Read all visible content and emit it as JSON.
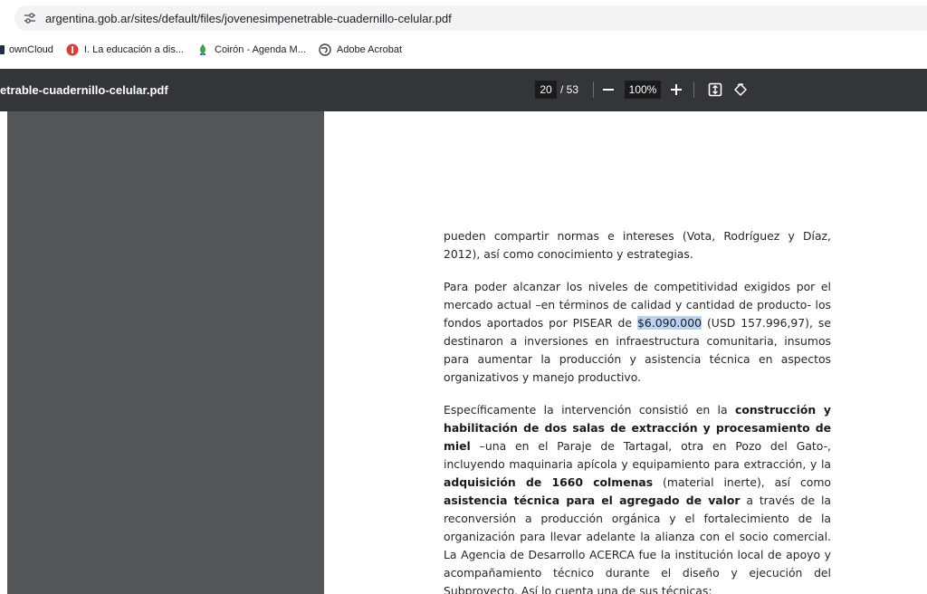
{
  "browser": {
    "url": "argentina.gob.ar/sites/default/files/jovenesimpenetrable-cuadernillo-celular.pdf",
    "bookmarks": [
      {
        "label": "ownCloud",
        "icon": "cloud-icon"
      },
      {
        "label": "I. La educación a dis...",
        "icon": "red-bookmark-icon"
      },
      {
        "label": "Coirón - Agenda M...",
        "icon": "plant-icon"
      },
      {
        "label": "Adobe Acrobat",
        "icon": "globe-icon"
      }
    ]
  },
  "pdf_toolbar": {
    "file_title": "etrable-cuadernillo-celular.pdf",
    "current_page": "20",
    "page_total": "/ 53",
    "zoom": "100%",
    "zoom_out_label": "—",
    "zoom_in_label": "+"
  },
  "document": {
    "p1": "pueden compartir normas e intereses (Vota, Rodríguez y Díaz, 2012), así como conocimiento y estrategias.",
    "p2_a": "Para poder alcanzar los niveles de competitividad exigidos por el mercado actual –en términos de calidad y cantidad de producto- los fondos aportados por PISEAR de ",
    "p2_highlight": "$6.090.000",
    "p2_b": " (USD 157.996,97), se destinaron a inversiones en infraestructura comunitaria, insumos para aumentar la producción y asistencia técnica en aspectos organizativos y manejo productivo.",
    "p3_a": "Específicamente la intervención consistió en la ",
    "p3_b1": "construcción y habilitación de dos salas de extracción y procesamiento de miel",
    "p3_c": " –una en el Paraje de Tartagal, otra en Pozo del Gato-, incluyendo maquinaria apícola y equipamiento para extracción, y la ",
    "p3_b2": "adquisición de 1660 colmenas",
    "p3_d": " (material inerte), así como ",
    "p3_b3": "asistencia técnica para el agregado de valor",
    "p3_e": " a través de la reconversión a producción orgánica y el fortalecimiento de la organización para llevar adelante la alianza con el socio comercial. La Agencia de Desarrollo ACERCA fue la institución local de apoyo y acompañamiento técnico durante el diseño y ejecución del Subproyecto. Así lo cuenta una de sus técnicas:"
  }
}
